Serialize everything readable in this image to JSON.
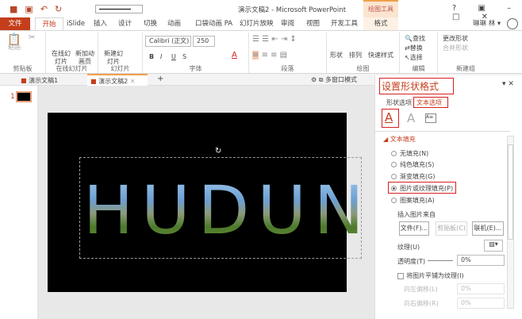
{
  "window": {
    "title": "演示文稿2 - Microsoft PowerPoint",
    "context_tab": "绘图工具",
    "help": "?",
    "user": "琳琳 林 ▾"
  },
  "tabs": [
    "文件",
    "开始",
    "iSlide",
    "插入",
    "设计",
    "切换",
    "动画",
    "口袋动画 PA",
    "幻灯片放映",
    "审阅",
    "视图",
    "开发工具",
    "格式"
  ],
  "ribbon": {
    "clipboard": {
      "paste": "粘贴",
      "label": "剪贴板"
    },
    "online": {
      "b1": "在线幻灯片",
      "b2": "新加动画页",
      "label": "在线幻灯片"
    },
    "slides": {
      "new": "新建幻灯片",
      "label": "幻灯片"
    },
    "font": {
      "name": "Calibri (正文)",
      "size": "250",
      "bold": "B",
      "italic": "I",
      "underline": "U",
      "strike": "S",
      "label": "字体"
    },
    "paragraph": {
      "label": "段落"
    },
    "drawing": {
      "shape": "形状",
      "arrange": "排列",
      "quick": "快速样式",
      "label": "绘图"
    },
    "editing": {
      "find": "查找",
      "replace": "替换",
      "select": "选择",
      "label": "编辑"
    },
    "newgroup": {
      "change": "更改形状",
      "merge": "合并形状",
      "label": "新建组"
    }
  },
  "doc_tabs": [
    "演示文稿1",
    "演示文稿2"
  ],
  "multiwin": "多窗口模式",
  "slide": {
    "number": "1",
    "text": "HUDUN"
  },
  "pane": {
    "title": "设置形状格式",
    "tab1": "形状选项",
    "tab2": "文本选项",
    "section": "文本填充",
    "options": [
      "无填充(N)",
      "纯色填充(S)",
      "渐变填充(G)",
      "图片或纹理填充(P)",
      "图案填充(A)"
    ],
    "selected_index": 3,
    "insert_from": "插入图片来自",
    "file_btn": "文件(F)...",
    "clip_btn": "剪贴板(C)",
    "online_btn": "联机(E)...",
    "texture": "纹理(U)",
    "transparency_label": "透明度(T)",
    "transparency": "0%",
    "tile_label": "将图片平铺为纹理(I)",
    "offset_left_label": "向左偏移(L)",
    "offset_left": "0%",
    "offset_right_label": "向右偏移(R)",
    "offset_right": "0%"
  },
  "colors": {
    "accent": "#b7472a",
    "highlight": "#d62020"
  }
}
